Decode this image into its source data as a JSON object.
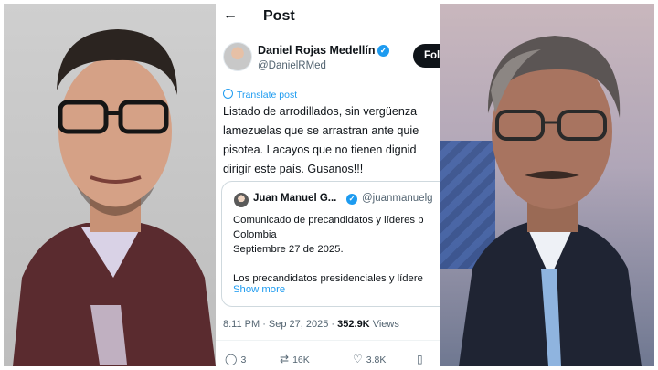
{
  "post": {
    "header_title": "Post",
    "author": {
      "name": "Daniel Rojas Medellín",
      "handle": "@DanielRMed",
      "follow_label": "Follow"
    },
    "translate_label": "Translate post",
    "text_lines": [
      "Listado de arrodillados, sin vergüenza",
      "lamezuelas que se arrastran ante quie",
      "pisotea. Lacayos que no tienen dignid",
      "dirigir este país. Gusanos!!!"
    ],
    "quote": {
      "name": "Juan Manuel G...",
      "handle": "@juanmanuelg",
      "text_lines": [
        "Comunicado de precandidatos y líderes p",
        "Colombia",
        "Septiembre 27 de 2025.",
        "",
        "Los precandidatos presidenciales y lídere"
      ],
      "show_more": "Show more"
    },
    "meta": {
      "time_date": "8:11 PM · Sep 27, 2025 · ",
      "views_count": "352.9K",
      "views_label": " Views"
    },
    "actions": {
      "replies": "3",
      "reposts": "16K",
      "likes": "3.8K"
    }
  },
  "colors": {
    "accent": "#1d9bf0",
    "text": "#0f1419",
    "secondary": "#536471"
  }
}
